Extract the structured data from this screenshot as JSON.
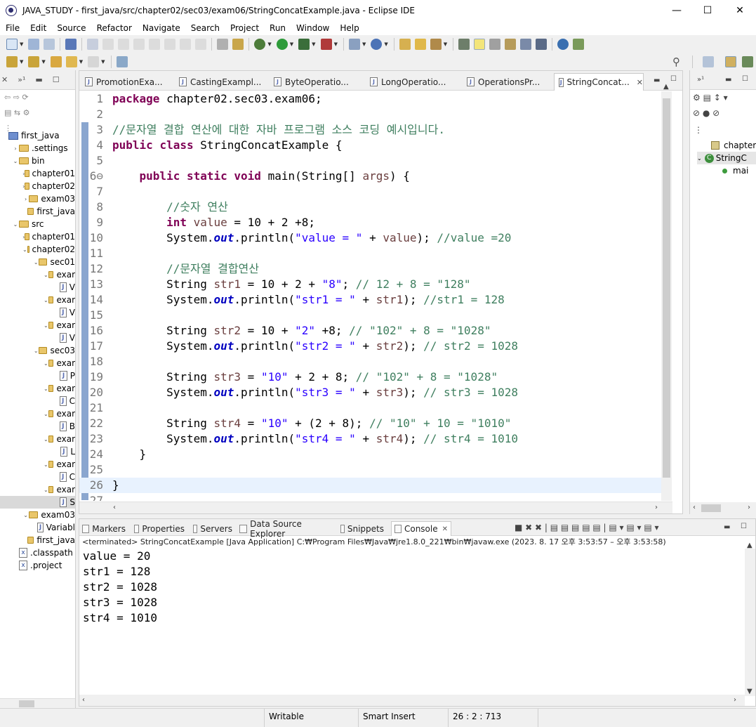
{
  "window": {
    "title": "JAVA_STUDY - first_java/src/chapter02/sec03/exam06/StringConcatExample.java - Eclipse IDE",
    "minimize": "—",
    "maximize": "☐",
    "close": "✕"
  },
  "menu": [
    "File",
    "Edit",
    "Source",
    "Refactor",
    "Navigate",
    "Search",
    "Project",
    "Run",
    "Window",
    "Help"
  ],
  "explorer": {
    "items": [
      {
        "indent": 0,
        "toggle": "",
        "icon": "project",
        "label": "first_java"
      },
      {
        "indent": 1,
        "toggle": "›",
        "icon": "folder",
        "label": ".settings"
      },
      {
        "indent": 1,
        "toggle": "⌄",
        "icon": "folder",
        "label": "bin"
      },
      {
        "indent": 2,
        "toggle": "›",
        "icon": "folder",
        "label": "chapter01"
      },
      {
        "indent": 2,
        "toggle": "›",
        "icon": "folder",
        "label": "chapter02"
      },
      {
        "indent": 2,
        "toggle": "›",
        "icon": "folder",
        "label": "exam03"
      },
      {
        "indent": 2,
        "toggle": "",
        "icon": "folder",
        "label": "first_java"
      },
      {
        "indent": 1,
        "toggle": "⌄",
        "icon": "folder",
        "label": "src"
      },
      {
        "indent": 2,
        "toggle": "›",
        "icon": "folder",
        "label": "chapter01"
      },
      {
        "indent": 2,
        "toggle": "⌄",
        "icon": "folder",
        "label": "chapter02"
      },
      {
        "indent": 3,
        "toggle": "⌄",
        "icon": "folder",
        "label": "sec01"
      },
      {
        "indent": 4,
        "toggle": "⌄",
        "icon": "folder",
        "label": "exar"
      },
      {
        "indent": 5,
        "toggle": "",
        "icon": "java",
        "label": "V"
      },
      {
        "indent": 4,
        "toggle": "⌄",
        "icon": "folder",
        "label": "exar"
      },
      {
        "indent": 5,
        "toggle": "",
        "icon": "java",
        "label": "V"
      },
      {
        "indent": 4,
        "toggle": "⌄",
        "icon": "folder",
        "label": "exar"
      },
      {
        "indent": 5,
        "toggle": "",
        "icon": "java",
        "label": "V"
      },
      {
        "indent": 3,
        "toggle": "⌄",
        "icon": "folder",
        "label": "sec03"
      },
      {
        "indent": 4,
        "toggle": "⌄",
        "icon": "folder",
        "label": "exar"
      },
      {
        "indent": 5,
        "toggle": "",
        "icon": "java",
        "label": "P"
      },
      {
        "indent": 4,
        "toggle": "⌄",
        "icon": "folder",
        "label": "exar"
      },
      {
        "indent": 5,
        "toggle": "",
        "icon": "java",
        "label": "C"
      },
      {
        "indent": 4,
        "toggle": "⌄",
        "icon": "folder",
        "label": "exar"
      },
      {
        "indent": 5,
        "toggle": "",
        "icon": "java",
        "label": "B"
      },
      {
        "indent": 4,
        "toggle": "⌄",
        "icon": "folder",
        "label": "exar"
      },
      {
        "indent": 5,
        "toggle": "",
        "icon": "java",
        "label": "L"
      },
      {
        "indent": 4,
        "toggle": "⌄",
        "icon": "folder",
        "label": "exar"
      },
      {
        "indent": 5,
        "toggle": "",
        "icon": "java",
        "label": "C"
      },
      {
        "indent": 4,
        "toggle": "⌄",
        "icon": "folder",
        "label": "exar"
      },
      {
        "indent": 5,
        "toggle": "",
        "icon": "java",
        "label": "S",
        "selected": true
      },
      {
        "indent": 2,
        "toggle": "⌄",
        "icon": "folder",
        "label": "exam03"
      },
      {
        "indent": 3,
        "toggle": "",
        "icon": "java",
        "label": "Variabl"
      },
      {
        "indent": 2,
        "toggle": "",
        "icon": "folder",
        "label": "first_java"
      },
      {
        "indent": 1,
        "toggle": "",
        "icon": "xml",
        "label": ".classpath"
      },
      {
        "indent": 1,
        "toggle": "",
        "icon": "xml",
        "label": ".project"
      }
    ]
  },
  "editor": {
    "tabs": [
      {
        "label": "PromotionExa...",
        "active": false
      },
      {
        "label": "CastingExampl...",
        "active": false
      },
      {
        "label": "ByteOperatio...",
        "active": false
      },
      {
        "label": "LongOperatio...",
        "active": false
      },
      {
        "label": "OperationsPr...",
        "active": false
      },
      {
        "label": "StringConcat...",
        "active": true
      }
    ],
    "lines": [
      [
        [
          "kw",
          "package"
        ],
        [
          "p",
          " chapter02.sec03.exam06;"
        ]
      ],
      [],
      [
        [
          "cm",
          "//문자열 결합 연산에 대한 자바 프로그램 소스 코딩 예시입니다."
        ]
      ],
      [
        [
          "kw",
          "public"
        ],
        [
          "p",
          " "
        ],
        [
          "kw",
          "class"
        ],
        [
          "p",
          " StringConcatExample {"
        ]
      ],
      [],
      [
        [
          "p",
          "    "
        ],
        [
          "kw",
          "public"
        ],
        [
          "p",
          " "
        ],
        [
          "kw",
          "static"
        ],
        [
          "p",
          " "
        ],
        [
          "kw",
          "void"
        ],
        [
          "p",
          " main(String[] "
        ],
        [
          "var",
          "args"
        ],
        [
          "p",
          ") {"
        ]
      ],
      [],
      [
        [
          "p",
          "        "
        ],
        [
          "cm",
          "//숫자 연산"
        ]
      ],
      [
        [
          "p",
          "        "
        ],
        [
          "kw",
          "int"
        ],
        [
          "p",
          " "
        ],
        [
          "var",
          "value"
        ],
        [
          "p",
          " = 10 + 2 +8;"
        ]
      ],
      [
        [
          "p",
          "        System."
        ],
        [
          "fld",
          "out"
        ],
        [
          "p",
          ".println("
        ],
        [
          "str",
          "\"value = \""
        ],
        [
          "p",
          " + "
        ],
        [
          "var",
          "value"
        ],
        [
          "p",
          "); "
        ],
        [
          "cm",
          "//value =20"
        ]
      ],
      [],
      [
        [
          "p",
          "        "
        ],
        [
          "cm",
          "//문자열 결합연산"
        ]
      ],
      [
        [
          "p",
          "        String "
        ],
        [
          "var",
          "str1"
        ],
        [
          "p",
          " = 10 + 2 + "
        ],
        [
          "str",
          "\"8\""
        ],
        [
          "p",
          "; "
        ],
        [
          "cm",
          "// 12 + 8 = \"128\""
        ]
      ],
      [
        [
          "p",
          "        System."
        ],
        [
          "fld",
          "out"
        ],
        [
          "p",
          ".println("
        ],
        [
          "str",
          "\"str1 = \""
        ],
        [
          "p",
          " + "
        ],
        [
          "var",
          "str1"
        ],
        [
          "p",
          "); "
        ],
        [
          "cm",
          "//str1 = 128"
        ]
      ],
      [],
      [
        [
          "p",
          "        String "
        ],
        [
          "var",
          "str2"
        ],
        [
          "p",
          " = 10 + "
        ],
        [
          "str",
          "\"2\""
        ],
        [
          "p",
          " +8; "
        ],
        [
          "cm",
          "// \"102\" + 8 = \"1028\""
        ]
      ],
      [
        [
          "p",
          "        System."
        ],
        [
          "fld",
          "out"
        ],
        [
          "p",
          ".println("
        ],
        [
          "str",
          "\"str2 = \""
        ],
        [
          "p",
          " + "
        ],
        [
          "var",
          "str2"
        ],
        [
          "p",
          "); "
        ],
        [
          "cm",
          "// str2 = 1028"
        ]
      ],
      [],
      [
        [
          "p",
          "        String "
        ],
        [
          "var",
          "str3"
        ],
        [
          "p",
          " = "
        ],
        [
          "str",
          "\"10\""
        ],
        [
          "p",
          " + 2 + 8; "
        ],
        [
          "cm",
          "// \"102\" + 8 = \"1028\""
        ]
      ],
      [
        [
          "p",
          "        System."
        ],
        [
          "fld",
          "out"
        ],
        [
          "p",
          ".println("
        ],
        [
          "str",
          "\"str3 = \""
        ],
        [
          "p",
          " + "
        ],
        [
          "var",
          "str3"
        ],
        [
          "p",
          "); "
        ],
        [
          "cm",
          "// str3 = 1028"
        ]
      ],
      [],
      [
        [
          "p",
          "        String "
        ],
        [
          "var",
          "str4"
        ],
        [
          "p",
          " = "
        ],
        [
          "str",
          "\"10\""
        ],
        [
          "p",
          " + (2 + 8); "
        ],
        [
          "cm",
          "// \"10\" + 10 = \"1010\""
        ]
      ],
      [
        [
          "p",
          "        System."
        ],
        [
          "fld",
          "out"
        ],
        [
          "p",
          ".println("
        ],
        [
          "str",
          "\"str4 = \""
        ],
        [
          "p",
          " + "
        ],
        [
          "var",
          "str4"
        ],
        [
          "p",
          "); "
        ],
        [
          "cm",
          "// str4 = 1010"
        ]
      ],
      [
        [
          "p",
          "    }"
        ]
      ],
      [],
      [
        [
          "p",
          "}"
        ]
      ],
      []
    ]
  },
  "outline": {
    "items": [
      {
        "label": "chapter",
        "kind": "package"
      },
      {
        "label": "StringC",
        "kind": "class"
      },
      {
        "label": "mai",
        "kind": "method"
      }
    ]
  },
  "console": {
    "tabs": [
      {
        "label": "Markers",
        "active": false
      },
      {
        "label": "Properties",
        "active": false
      },
      {
        "label": "Servers",
        "active": false
      },
      {
        "label": "Data Source Explorer",
        "active": false
      },
      {
        "label": "Snippets",
        "active": false
      },
      {
        "label": "Console",
        "active": true
      }
    ],
    "terminated": "<terminated> StringConcatExample [Java Application] C:₩Program Files₩Java₩jre1.8.0_221₩bin₩javaw.exe  (2023. 8. 17 오후 3:53:57 – 오후 3:53:58)",
    "output": [
      "value = 20",
      "str1 = 128",
      "str2 = 1028",
      "str3 = 1028",
      "str4 = 1010"
    ]
  },
  "status": {
    "writable": "Writable",
    "insert_mode": "Smart Insert",
    "position": "26 : 2 : 713"
  }
}
